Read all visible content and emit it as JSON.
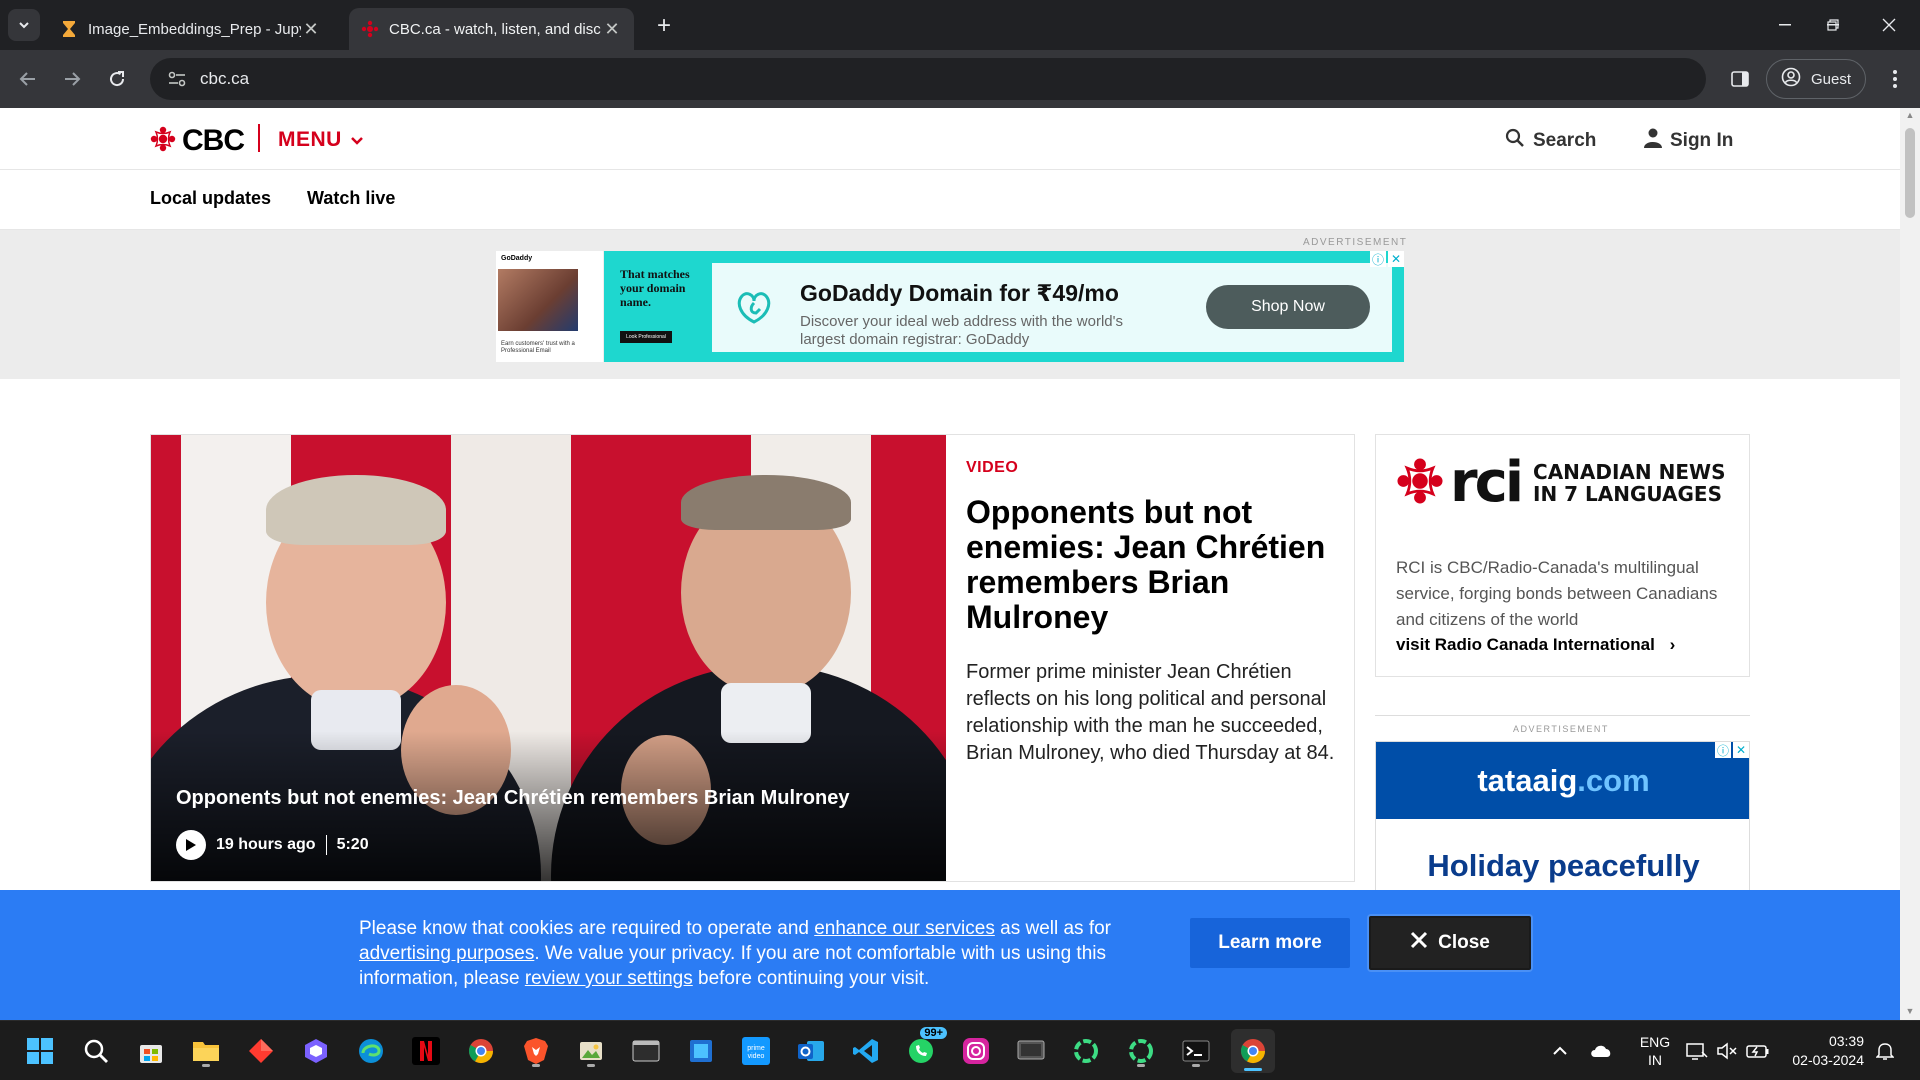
{
  "browser": {
    "tabs": [
      {
        "title": "Image_Embeddings_Prep - Jupy",
        "active": false
      },
      {
        "title": "CBC.ca - watch, listen, and disc",
        "active": true
      }
    ],
    "new_tab_icon": "plus-icon",
    "address": "cbc.ca",
    "profile_label": "Guest"
  },
  "header": {
    "logo_text": "CBC",
    "menu_label": "MENU",
    "search_label": "Search",
    "signin_label": "Sign In"
  },
  "subnav": {
    "items": [
      "Local updates",
      "Watch live"
    ]
  },
  "ad_top": {
    "label": "ADVERTISEMENT",
    "brand_small": "GoDaddy",
    "side_caption": "Earn customers' trust with a Professional Email",
    "mid_text": "That matches your domain name.",
    "mid_button": "Look Professional",
    "title": "GoDaddy Domain for ₹49/mo",
    "description": "Discover your ideal web address with the world's largest domain registrar: GoDaddy",
    "cta": "Shop Now"
  },
  "story": {
    "kicker": "VIDEO",
    "title": "Opponents but not enemies: Jean Chrétien remembers Brian Mulroney",
    "description": "Former prime minister Jean Chrétien reflects on his long political and personal relationship with the man he succeeded, Brian Mulroney, who died Thursday at 84.",
    "image_headline": "Opponents but not enemies: Jean Chrétien remembers Brian Mulroney",
    "time_ago": "19 hours ago",
    "duration": "5:20"
  },
  "rci": {
    "logo_word": "rci",
    "tagline_line1": "CANADIAN NEWS",
    "tagline_line2": "IN 7 LANGUAGES",
    "description": "RCI is CBC/Radio-Canada's multilingual service, forging bonds between Canadians and citizens of the world",
    "link": "visit Radio Canada International"
  },
  "ad_side": {
    "label": "ADVERTISEMENT",
    "domain_name": "tataaig",
    "domain_tld": ".com",
    "tagline": "Holiday peacefully"
  },
  "cookie": {
    "text_1": "Please know that cookies are required to operate and ",
    "link_1": "enhance our services",
    "text_2": " as well as for ",
    "link_2": "advertising purposes",
    "text_3": ". We value your privacy. If you are not comfortable with us using this information, please ",
    "link_3": "review your settings",
    "text_4": " before continuing your visit.",
    "learn_more": "Learn more",
    "close": "Close"
  },
  "taskbar": {
    "whatsapp_badge": "99+",
    "lang_line1": "ENG",
    "lang_line2": "IN",
    "time": "03:39",
    "date": "02-03-2024"
  },
  "colors": {
    "cbc_red": "#d5001c",
    "cookie_blue": "#2b7cf4",
    "godaddy_teal": "#1ed7cf"
  }
}
